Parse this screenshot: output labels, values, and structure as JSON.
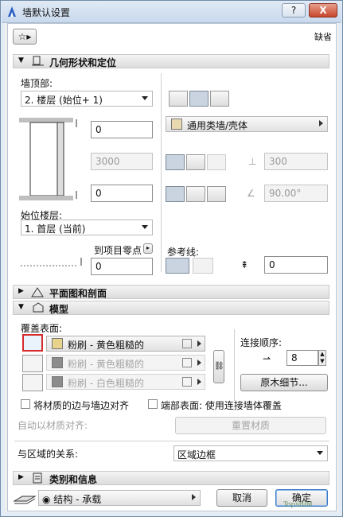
{
  "window": {
    "title": "墙默认设置",
    "help_label": "?",
    "close_label": "X"
  },
  "header": {
    "favorite_label": "☆▸",
    "right_label": "缺省"
  },
  "geometry": {
    "section_title": "几何形状和定位",
    "top_label": "墙顶部:",
    "top_link_value": "2. 楼层 (始位+ 1)",
    "offset_top": "0",
    "height": "3000",
    "offset_bottom": "0",
    "home_story_label": "始位楼层:",
    "home_story_value": "1. 首层 (当前)",
    "to_project_zero_label": "到项目零点",
    "to_project_zero_value": "0",
    "building_material": "通用类墙/壳体",
    "thickness": "300",
    "angle": "90.00°",
    "ref_line_label": "参考线:",
    "ref_offset": "0"
  },
  "plan_section": {
    "section_title": "平面图和剖面"
  },
  "model": {
    "section_title": "模型",
    "override_label": "覆盖表面:",
    "surfaces": [
      {
        "label": "粉刷 - 黄色粗糙的",
        "color": "#e8d38c"
      },
      {
        "label": "粉刷 - 黄色粗糙的",
        "color": "#8c8c8c"
      },
      {
        "label": "粉刷 - 白色粗糙的",
        "color": "#8c8c8c"
      }
    ],
    "connection_order_label": "连接顺序:",
    "connection_order_value": "8",
    "log_details_label": "原木细节...",
    "align_edge_label": "将材质的边与墙边对齐",
    "end_surface_label": "端部表面: 使用连接墙体覆盖",
    "auto_align_label": "自动以材质对齐:",
    "reset_label": "重置材质",
    "zone_relation_label": "与区域的关系:",
    "zone_relation_value": "区域边框"
  },
  "classification": {
    "section_title": "类别和信息"
  },
  "footer": {
    "layer_value": "结构 - 承载",
    "cancel_label": "取消",
    "ok_label": "确定",
    "watermark": "TopsBIM"
  },
  "colors": {
    "accent": "#d52b2b",
    "titlebar": "#c9d9ec"
  }
}
